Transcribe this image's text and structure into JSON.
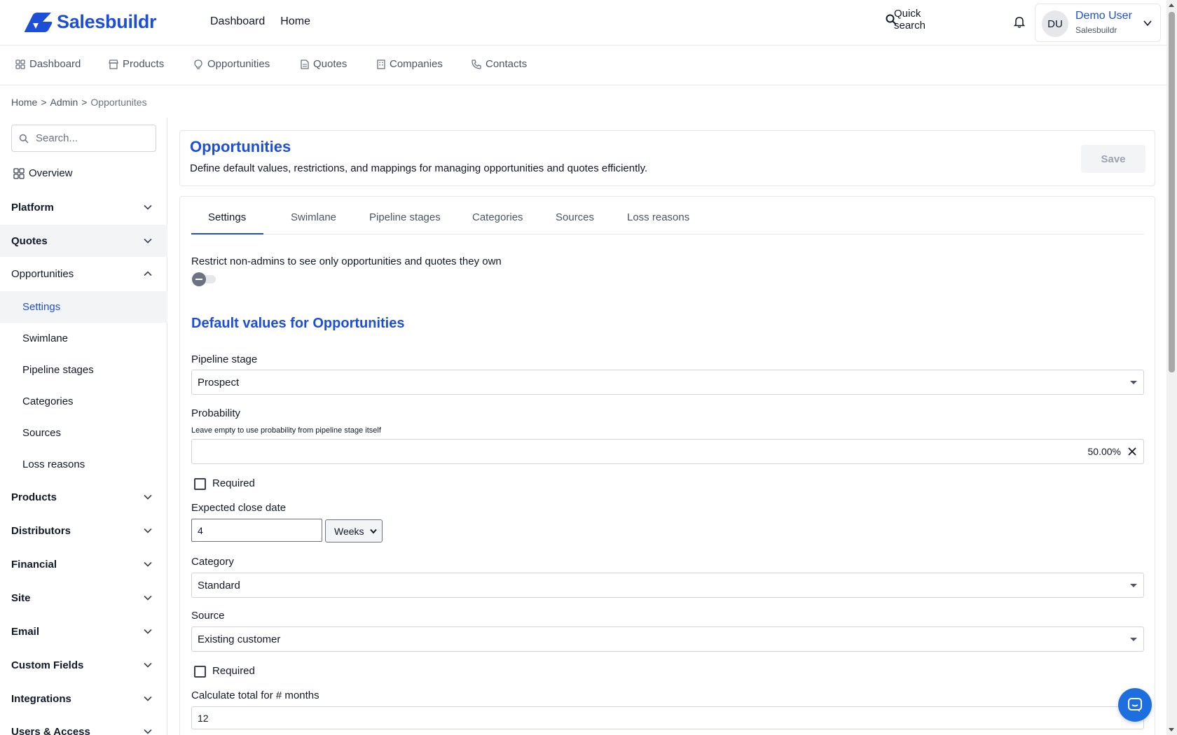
{
  "app": {
    "brand": "Salesbuildr",
    "brand_color": "#1d4ed8"
  },
  "header": {
    "nav": [
      "Dashboard",
      "Home"
    ],
    "search_placeholder": "Quick search",
    "user": {
      "initials": "DU",
      "name": "Demo User",
      "org": "Salesbuildr"
    }
  },
  "modules": [
    {
      "label": "Dashboard",
      "icon": "grid-icon"
    },
    {
      "label": "Products",
      "icon": "store-icon"
    },
    {
      "label": "Opportunities",
      "icon": "lightbulb-icon"
    },
    {
      "label": "Quotes",
      "icon": "document-icon"
    },
    {
      "label": "Companies",
      "icon": "building-icon"
    },
    {
      "label": "Contacts",
      "icon": "phone-icon"
    }
  ],
  "breadcrumb": {
    "items": [
      "Home",
      "Admin"
    ],
    "current": "Opportunites",
    "separator": ">"
  },
  "sidebar": {
    "search_placeholder": "Search...",
    "overview": "Overview",
    "groups": [
      {
        "label": "Platform",
        "expanded": false
      },
      {
        "label": "Quotes",
        "expanded": false
      },
      {
        "label": "Opportunities",
        "expanded": true
      }
    ],
    "opportunity_items": [
      {
        "label": "Settings",
        "active": true
      },
      {
        "label": "Swimlane",
        "active": false
      },
      {
        "label": "Pipeline stages",
        "active": false
      },
      {
        "label": "Categories",
        "active": false
      },
      {
        "label": "Sources",
        "active": false
      },
      {
        "label": "Loss reasons",
        "active": false
      }
    ],
    "more_groups": [
      "Products",
      "Distributors",
      "Financial",
      "Site",
      "Email",
      "Custom Fields",
      "Integrations",
      "Users & Access"
    ]
  },
  "page": {
    "title": "Opportunities",
    "description": "Define default values, restrictions, and mappings for managing opportunities and quotes efficiently.",
    "save_label": "Save",
    "tabs": [
      "Settings",
      "Swimlane",
      "Pipeline stages",
      "Categories",
      "Sources",
      "Loss reasons"
    ],
    "active_tab": "Settings"
  },
  "form": {
    "restrict_label": "Restrict non-admins to see only opportunities and quotes they own",
    "restrict_enabled": false,
    "section_title": "Default values for Opportunities",
    "pipeline_stage": {
      "label": "Pipeline stage",
      "value": "Prospect"
    },
    "probability": {
      "label": "Probability",
      "hint": "Leave empty to use probability from pipeline stage itself",
      "value": "50.00%"
    },
    "required_label": "Required",
    "probability_required": false,
    "expected_close": {
      "label": "Expected close date",
      "value": "4",
      "unit": "Weeks"
    },
    "category": {
      "label": "Category",
      "value": "Standard"
    },
    "source": {
      "label": "Source",
      "value": "Existing customer"
    },
    "source_required": false,
    "months": {
      "label": "Calculate total for # months",
      "value": "12"
    }
  }
}
